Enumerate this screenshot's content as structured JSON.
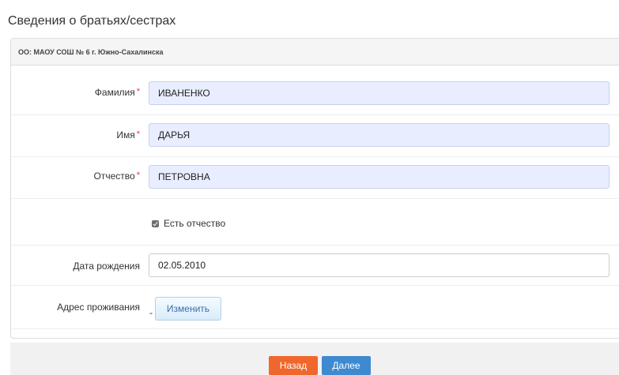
{
  "page": {
    "title": "Сведения о братьях/сестрах"
  },
  "panel": {
    "organization": "ОО: МАОУ СОШ № 6 г. Южно-Сахалинска"
  },
  "form": {
    "required_mark": "*",
    "last_name": {
      "label": "Фамилия",
      "value": "ИВАНЕНКО"
    },
    "first_name": {
      "label": "Имя",
      "value": "ДАРЬЯ"
    },
    "patronymic": {
      "label": "Отчество",
      "value": "ПЕТРОВНА"
    },
    "has_patronymic": {
      "label": "Есть отчество",
      "checked": true
    },
    "birth_date": {
      "label": "Дата рождения",
      "value": "02.05.2010"
    },
    "address": {
      "label": "Адрес проживания",
      "value": "-",
      "change_label": "Изменить"
    }
  },
  "footer": {
    "back_label": "Назад",
    "next_label": "Далее"
  },
  "colors": {
    "required": "#e53935",
    "back_button": "#f0672d",
    "next_button": "#3d8ad1",
    "input_highlight": "#e8eeff"
  }
}
